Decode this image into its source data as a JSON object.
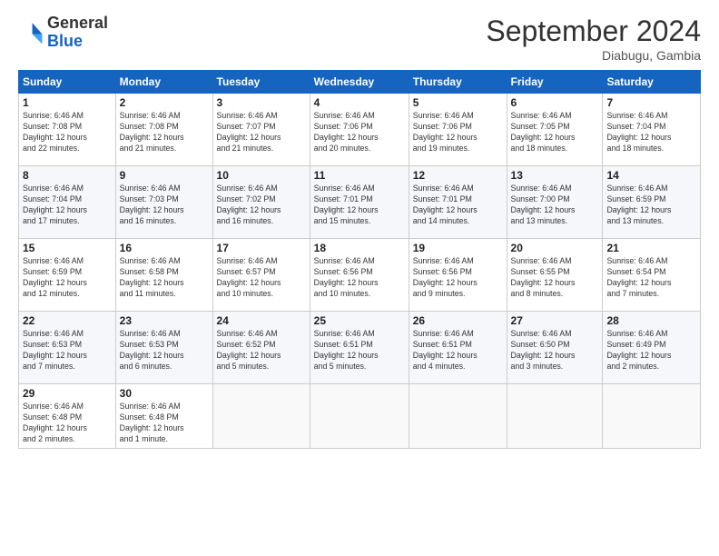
{
  "header": {
    "logo_general": "General",
    "logo_blue": "Blue",
    "month_title": "September 2024",
    "location": "Diabugu, Gambia"
  },
  "days_of_week": [
    "Sunday",
    "Monday",
    "Tuesday",
    "Wednesday",
    "Thursday",
    "Friday",
    "Saturday"
  ],
  "weeks": [
    [
      {
        "day": "1",
        "info": "Sunrise: 6:46 AM\nSunset: 7:08 PM\nDaylight: 12 hours\nand 22 minutes."
      },
      {
        "day": "2",
        "info": "Sunrise: 6:46 AM\nSunset: 7:08 PM\nDaylight: 12 hours\nand 21 minutes."
      },
      {
        "day": "3",
        "info": "Sunrise: 6:46 AM\nSunset: 7:07 PM\nDaylight: 12 hours\nand 21 minutes."
      },
      {
        "day": "4",
        "info": "Sunrise: 6:46 AM\nSunset: 7:06 PM\nDaylight: 12 hours\nand 20 minutes."
      },
      {
        "day": "5",
        "info": "Sunrise: 6:46 AM\nSunset: 7:06 PM\nDaylight: 12 hours\nand 19 minutes."
      },
      {
        "day": "6",
        "info": "Sunrise: 6:46 AM\nSunset: 7:05 PM\nDaylight: 12 hours\nand 18 minutes."
      },
      {
        "day": "7",
        "info": "Sunrise: 6:46 AM\nSunset: 7:04 PM\nDaylight: 12 hours\nand 18 minutes."
      }
    ],
    [
      {
        "day": "8",
        "info": "Sunrise: 6:46 AM\nSunset: 7:04 PM\nDaylight: 12 hours\nand 17 minutes."
      },
      {
        "day": "9",
        "info": "Sunrise: 6:46 AM\nSunset: 7:03 PM\nDaylight: 12 hours\nand 16 minutes."
      },
      {
        "day": "10",
        "info": "Sunrise: 6:46 AM\nSunset: 7:02 PM\nDaylight: 12 hours\nand 16 minutes."
      },
      {
        "day": "11",
        "info": "Sunrise: 6:46 AM\nSunset: 7:01 PM\nDaylight: 12 hours\nand 15 minutes."
      },
      {
        "day": "12",
        "info": "Sunrise: 6:46 AM\nSunset: 7:01 PM\nDaylight: 12 hours\nand 14 minutes."
      },
      {
        "day": "13",
        "info": "Sunrise: 6:46 AM\nSunset: 7:00 PM\nDaylight: 12 hours\nand 13 minutes."
      },
      {
        "day": "14",
        "info": "Sunrise: 6:46 AM\nSunset: 6:59 PM\nDaylight: 12 hours\nand 13 minutes."
      }
    ],
    [
      {
        "day": "15",
        "info": "Sunrise: 6:46 AM\nSunset: 6:59 PM\nDaylight: 12 hours\nand 12 minutes."
      },
      {
        "day": "16",
        "info": "Sunrise: 6:46 AM\nSunset: 6:58 PM\nDaylight: 12 hours\nand 11 minutes."
      },
      {
        "day": "17",
        "info": "Sunrise: 6:46 AM\nSunset: 6:57 PM\nDaylight: 12 hours\nand 10 minutes."
      },
      {
        "day": "18",
        "info": "Sunrise: 6:46 AM\nSunset: 6:56 PM\nDaylight: 12 hours\nand 10 minutes."
      },
      {
        "day": "19",
        "info": "Sunrise: 6:46 AM\nSunset: 6:56 PM\nDaylight: 12 hours\nand 9 minutes."
      },
      {
        "day": "20",
        "info": "Sunrise: 6:46 AM\nSunset: 6:55 PM\nDaylight: 12 hours\nand 8 minutes."
      },
      {
        "day": "21",
        "info": "Sunrise: 6:46 AM\nSunset: 6:54 PM\nDaylight: 12 hours\nand 7 minutes."
      }
    ],
    [
      {
        "day": "22",
        "info": "Sunrise: 6:46 AM\nSunset: 6:53 PM\nDaylight: 12 hours\nand 7 minutes."
      },
      {
        "day": "23",
        "info": "Sunrise: 6:46 AM\nSunset: 6:53 PM\nDaylight: 12 hours\nand 6 minutes."
      },
      {
        "day": "24",
        "info": "Sunrise: 6:46 AM\nSunset: 6:52 PM\nDaylight: 12 hours\nand 5 minutes."
      },
      {
        "day": "25",
        "info": "Sunrise: 6:46 AM\nSunset: 6:51 PM\nDaylight: 12 hours\nand 5 minutes."
      },
      {
        "day": "26",
        "info": "Sunrise: 6:46 AM\nSunset: 6:51 PM\nDaylight: 12 hours\nand 4 minutes."
      },
      {
        "day": "27",
        "info": "Sunrise: 6:46 AM\nSunset: 6:50 PM\nDaylight: 12 hours\nand 3 minutes."
      },
      {
        "day": "28",
        "info": "Sunrise: 6:46 AM\nSunset: 6:49 PM\nDaylight: 12 hours\nand 2 minutes."
      }
    ],
    [
      {
        "day": "29",
        "info": "Sunrise: 6:46 AM\nSunset: 6:48 PM\nDaylight: 12 hours\nand 2 minutes."
      },
      {
        "day": "30",
        "info": "Sunrise: 6:46 AM\nSunset: 6:48 PM\nDaylight: 12 hours\nand 1 minute."
      },
      {
        "day": "",
        "info": ""
      },
      {
        "day": "",
        "info": ""
      },
      {
        "day": "",
        "info": ""
      },
      {
        "day": "",
        "info": ""
      },
      {
        "day": "",
        "info": ""
      }
    ]
  ]
}
